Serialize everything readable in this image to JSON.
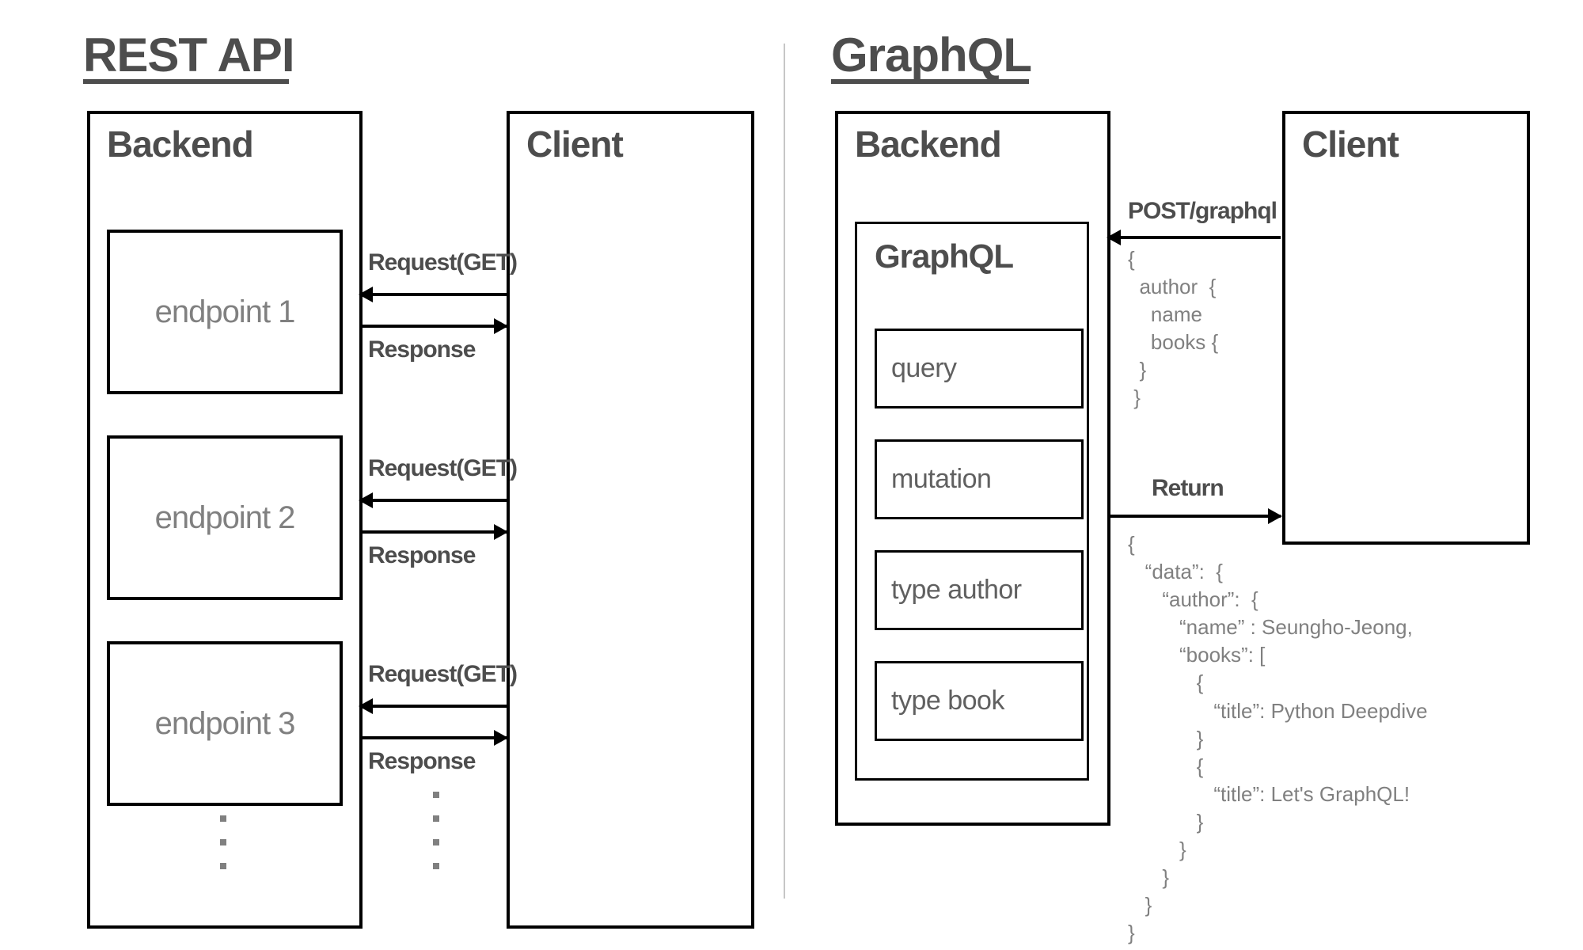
{
  "left": {
    "title": "REST API",
    "backend": "Backend",
    "client": "Client",
    "endpoints": [
      "endpoint 1",
      "endpoint 2",
      "endpoint 3"
    ],
    "request_label": "Request(GET)",
    "response_label": "Response"
  },
  "right": {
    "title": "GraphQL",
    "backend": "Backend",
    "client": "Client",
    "graphql_header": "GraphQL",
    "items": [
      "query",
      "mutation",
      "type author",
      "type book"
    ],
    "post_label": "POST/graphql",
    "return_label": "Return",
    "query_code": "{\n  author  {\n    name\n    books {\n  }\n }",
    "response_code": "{\n   “data”:  {\n      “author”:  {\n         “name” : Seungho-Jeong,\n         “books”: [\n            {\n               “title”: Python Deepdive\n            }\n            {\n               “title”: Let's GraphQL!\n            }\n         }\n      }\n   }\n}"
  }
}
